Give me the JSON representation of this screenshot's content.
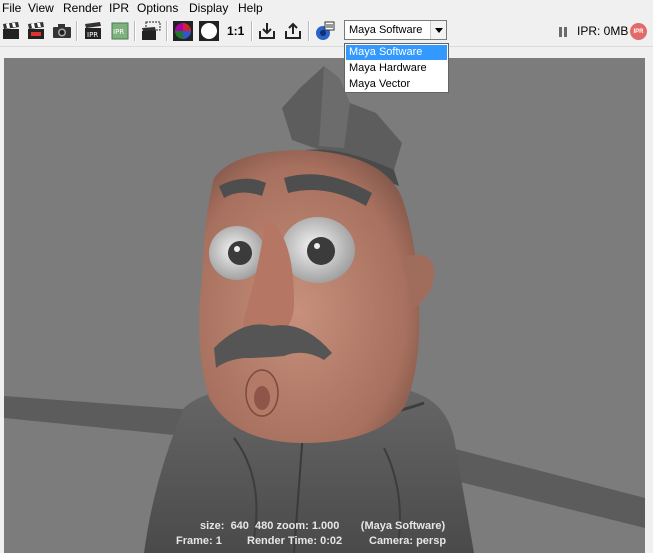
{
  "menu": [
    "File",
    "View",
    "Render",
    "IPR",
    "Options",
    "Display",
    "Help"
  ],
  "toolbar": {
    "ratio_label": "1:1",
    "renderer": {
      "selected": "Maya Software",
      "options": [
        "Maya Software",
        "Maya Hardware",
        "Maya Vector"
      ]
    },
    "ipr_memory": "IPR: 0MB",
    "ipr_badge": "IPR",
    "icons": [
      "clapper-render-icon",
      "clapper-redo-icon",
      "camera-snapshot-icon",
      "ipr-render-icon",
      "ipr-refresh-icon",
      "render-region-icon",
      "color-channels-icon",
      "alpha-channel-icon",
      "keep-image-icon",
      "remove-image-icon",
      "render-settings-icon"
    ]
  },
  "render_info": {
    "line1": "size:  640  480 zoom: 1.000       (Maya Software)",
    "frame": "Frame: 1",
    "render_time": "Render Time: 0:02",
    "camera": "Camera: persp"
  },
  "colors": {
    "viewport_bg": "#7c7c7c",
    "selection": "#3399ff",
    "skin": "#b47a68",
    "uniform": "#555555"
  }
}
